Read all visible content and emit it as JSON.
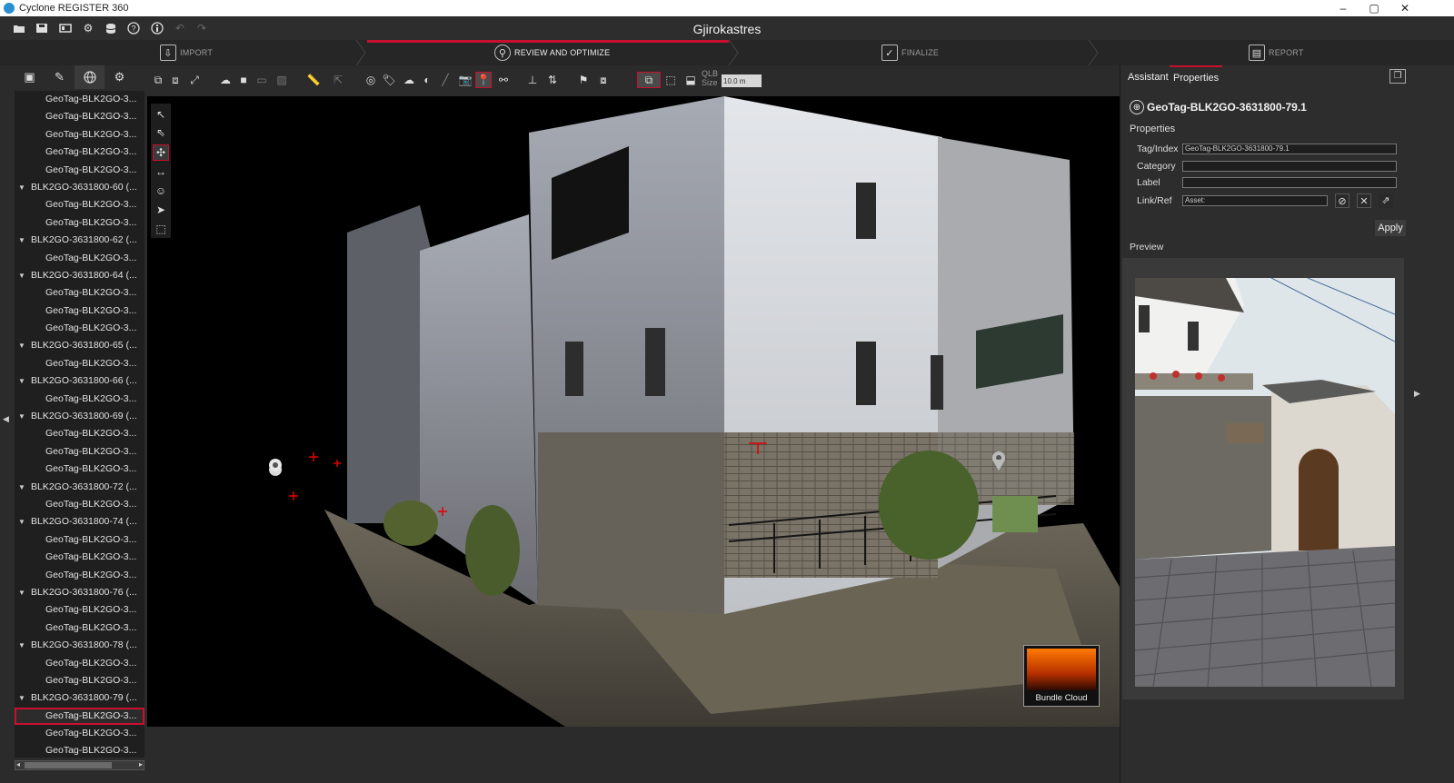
{
  "titlebar": {
    "title": "Cyclone REGISTER 360",
    "min": "–",
    "max": "▢",
    "close": "✕"
  },
  "project": {
    "name": "Gjirokastres"
  },
  "workflow": {
    "steps": [
      {
        "label": "IMPORT"
      },
      {
        "label": "REVIEW AND OPTIMIZE"
      },
      {
        "label": "FINALIZE"
      },
      {
        "label": "REPORT"
      }
    ]
  },
  "tree": {
    "rows": [
      {
        "t": "c",
        "label": "GeoTag-BLK2GO-3..."
      },
      {
        "t": "c",
        "label": "GeoTag-BLK2GO-3..."
      },
      {
        "t": "c",
        "label": "GeoTag-BLK2GO-3..."
      },
      {
        "t": "c",
        "label": "GeoTag-BLK2GO-3..."
      },
      {
        "t": "c",
        "label": "GeoTag-BLK2GO-3..."
      },
      {
        "t": "p",
        "label": "BLK2GO-3631800-60 (..."
      },
      {
        "t": "c",
        "label": "GeoTag-BLK2GO-3..."
      },
      {
        "t": "c",
        "label": "GeoTag-BLK2GO-3..."
      },
      {
        "t": "p",
        "label": "BLK2GO-3631800-62 (..."
      },
      {
        "t": "c",
        "label": "GeoTag-BLK2GO-3..."
      },
      {
        "t": "p",
        "label": "BLK2GO-3631800-64 (..."
      },
      {
        "t": "c",
        "label": "GeoTag-BLK2GO-3..."
      },
      {
        "t": "c",
        "label": "GeoTag-BLK2GO-3..."
      },
      {
        "t": "c",
        "label": "GeoTag-BLK2GO-3..."
      },
      {
        "t": "p",
        "label": "BLK2GO-3631800-65 (..."
      },
      {
        "t": "c",
        "label": "GeoTag-BLK2GO-3..."
      },
      {
        "t": "p",
        "label": "BLK2GO-3631800-66 (..."
      },
      {
        "t": "c",
        "label": "GeoTag-BLK2GO-3..."
      },
      {
        "t": "p",
        "label": "BLK2GO-3631800-69 (..."
      },
      {
        "t": "c",
        "label": "GeoTag-BLK2GO-3..."
      },
      {
        "t": "c",
        "label": "GeoTag-BLK2GO-3..."
      },
      {
        "t": "c",
        "label": "GeoTag-BLK2GO-3..."
      },
      {
        "t": "p",
        "label": "BLK2GO-3631800-72 (..."
      },
      {
        "t": "c",
        "label": "GeoTag-BLK2GO-3..."
      },
      {
        "t": "p",
        "label": "BLK2GO-3631800-74 (..."
      },
      {
        "t": "c",
        "label": "GeoTag-BLK2GO-3..."
      },
      {
        "t": "c",
        "label": "GeoTag-BLK2GO-3..."
      },
      {
        "t": "c",
        "label": "GeoTag-BLK2GO-3..."
      },
      {
        "t": "p",
        "label": "BLK2GO-3631800-76 (..."
      },
      {
        "t": "c",
        "label": "GeoTag-BLK2GO-3..."
      },
      {
        "t": "c",
        "label": "GeoTag-BLK2GO-3..."
      },
      {
        "t": "p",
        "label": "BLK2GO-3631800-78 (..."
      },
      {
        "t": "c",
        "label": "GeoTag-BLK2GO-3..."
      },
      {
        "t": "c",
        "label": "GeoTag-BLK2GO-3..."
      },
      {
        "t": "p",
        "label": "BLK2GO-3631800-79 (..."
      },
      {
        "t": "c",
        "label": "GeoTag-BLK2GO-3...",
        "selected": true
      },
      {
        "t": "c",
        "label": "GeoTag-BLK2GO-3..."
      },
      {
        "t": "c",
        "label": "GeoTag-BLK2GO-3..."
      }
    ]
  },
  "toolbar": {
    "qlb_label": "QLB Size",
    "qlb_value": "10.0 m"
  },
  "viewport": {
    "bundle_label": "Bundle Cloud"
  },
  "rightpanel": {
    "tab_assistant": "Assistant",
    "tab_properties": "Properties",
    "object_title": "GeoTag-BLK2GO-3631800-79.1",
    "properties_heading": "Properties",
    "fields": {
      "tag_label": "Tag/Index",
      "tag_value": "GeoTag-BLK2GO-3631800-79.1",
      "category_label": "Category",
      "category_value": "",
      "label_label": "Label",
      "label_value": "",
      "link_label": "Link/Ref",
      "link_value": "Asset:"
    },
    "apply": "Apply",
    "preview_heading": "Preview"
  },
  "icons": [
    "folder-open-icon",
    "save-icon",
    "project-icon",
    "settings-icon",
    "database-icon",
    "help-icon",
    "info-icon",
    "undo-icon",
    "redo-icon",
    "select-icon",
    "globe-icon",
    "geotag-icon",
    "bundle-cloud-icon",
    "geotag-pin-icon"
  ],
  "colors": {
    "accent": "#c8102e",
    "background": "#2b2b2b",
    "viewport": "#000000"
  }
}
